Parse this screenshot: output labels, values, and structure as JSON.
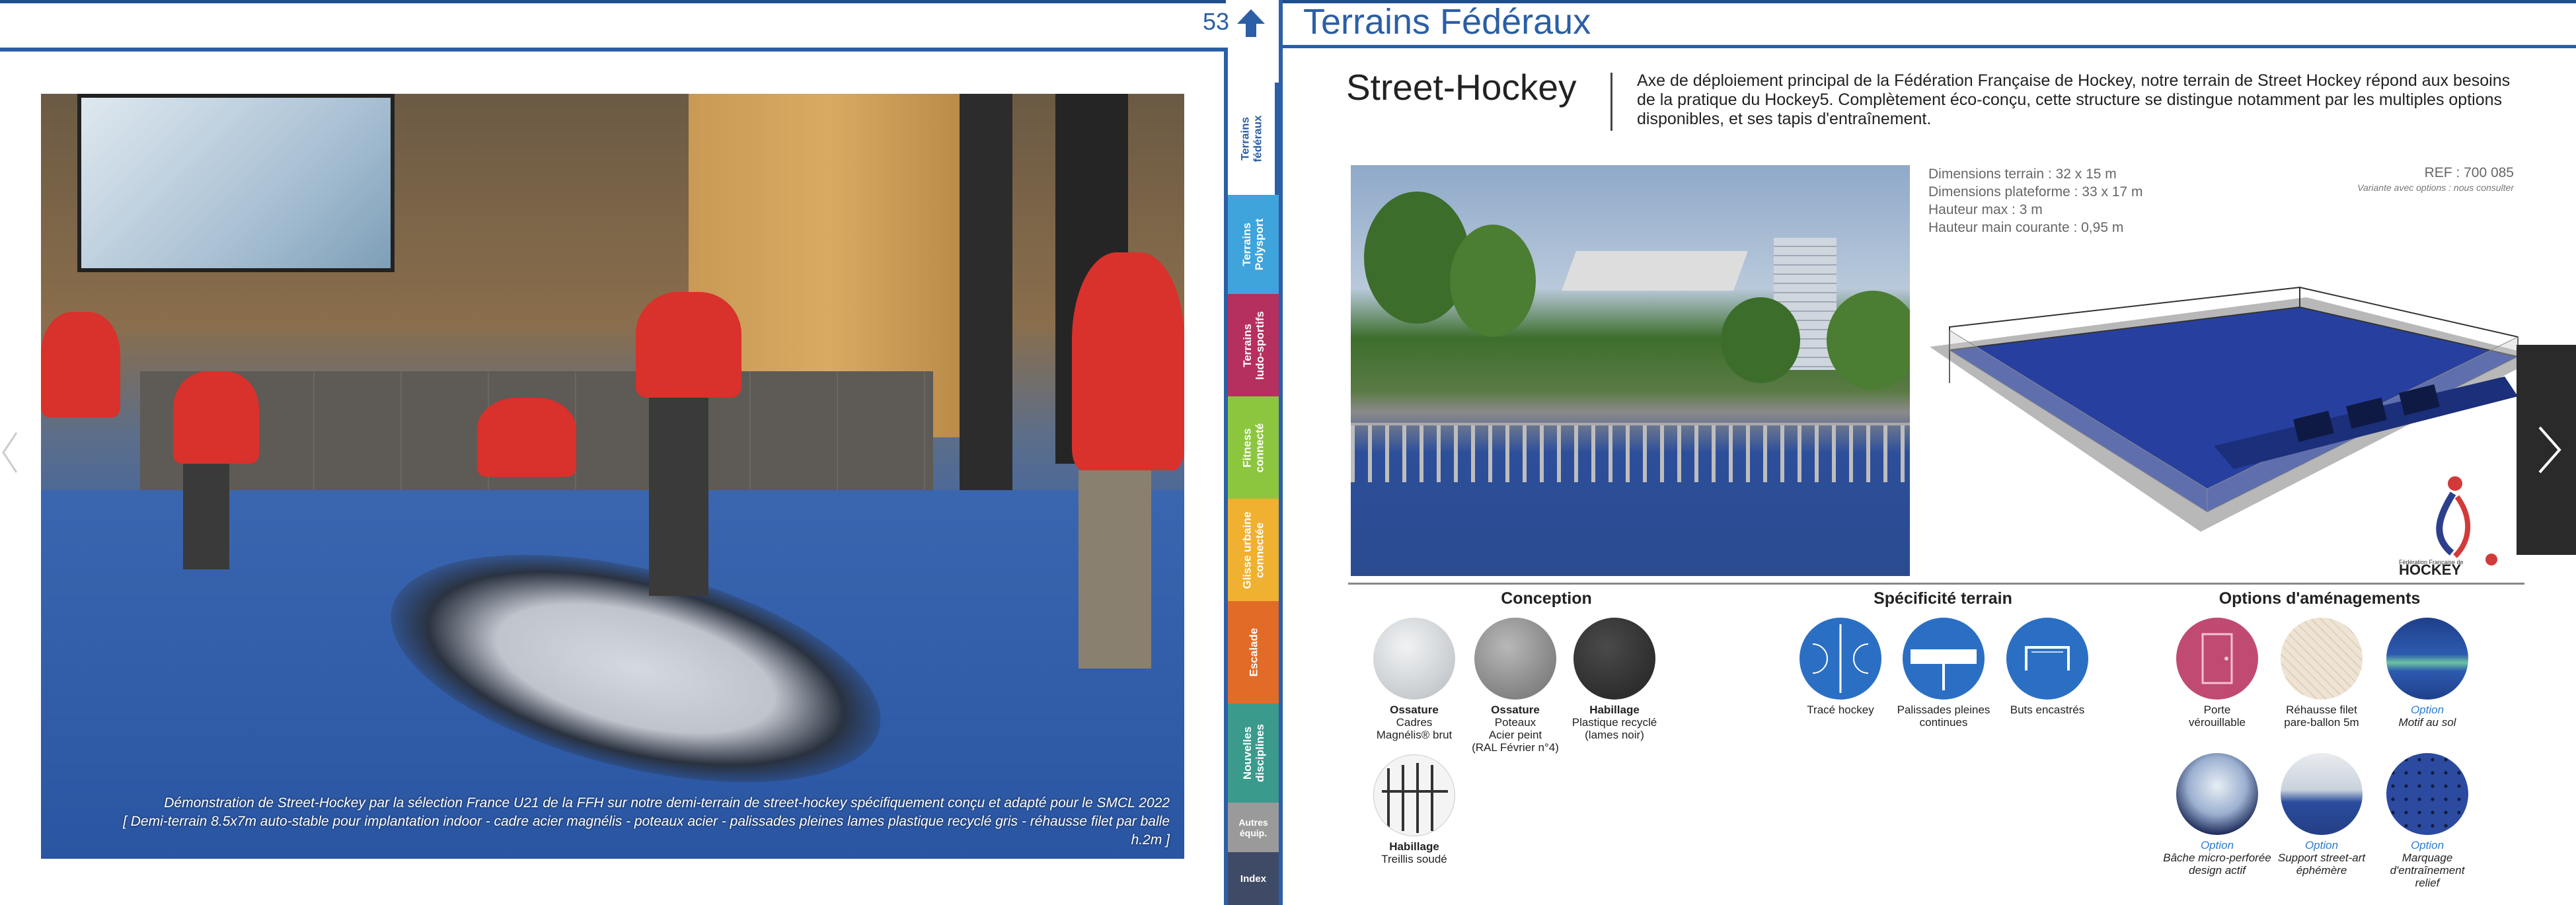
{
  "left_page": {
    "page_number": "53",
    "caption_line1": "Démonstration de Street-Hockey par la sélection France U21 de la FFH sur notre demi-terrain de street-hockey spécifiquement conçu et adapté pour le SMCL 2022",
    "caption_line2": "[ Demi-terrain 8.5x7m auto-stable pour implantation indoor - cadre acier magnélis - poteaux acier - palissades pleines lames plastique recyclé gris - réhausse filet par balle h.2m ]"
  },
  "tabs": [
    {
      "label": "Terrains\nfédéraux",
      "color": "#ffffff",
      "active": true
    },
    {
      "label": "Terrains\nPolysport",
      "color": "#3fa4db",
      "active": false
    },
    {
      "label": "Terrains\nludo-sportifs",
      "color": "#b52f5f",
      "active": false
    },
    {
      "label": "Fitness\nconnecté",
      "color": "#8cc63e",
      "active": false
    },
    {
      "label": "Glisse urbaine\nconnectée",
      "color": "#f0b030",
      "active": false
    },
    {
      "label": "Escalade",
      "color": "#e26b27",
      "active": false
    },
    {
      "label": "Nouvelles\ndisciplines",
      "color": "#3a9a8c",
      "active": false
    },
    {
      "label": "Autres\néquip.",
      "color": "#9a9a9a",
      "active": false
    },
    {
      "label": "Index",
      "color": "#3f4a66",
      "active": false
    }
  ],
  "right_page": {
    "section_title": "Terrains Fédéraux",
    "product_title": "Street-Hockey",
    "intro": "Axe de déploiement principal de la Fédération Française de Hockey, notre terrain de Street Hockey répond aux besoins de la pratique du Hockey5. Complètement éco-conçu, cette structure se distingue notamment par les multiples options disponibles, et ses tapis d'entraînement.",
    "specs": [
      "Dimensions terrain : 32 x 15 m",
      "Dimensions plateforme : 33 x 17 m",
      "Hauteur max : 3 m",
      "Hauteur main courante : 0,95 m"
    ],
    "ref": "REF : 700 085",
    "ref_note": "Variante avec options : nous consulter",
    "logo_text_small": "Fédération Française de",
    "logo_text_big": "HOCKEY",
    "conception": {
      "title": "Conception",
      "items": [
        {
          "title": "Ossature",
          "line1": "Cadres",
          "line2": "Magnélis® brut",
          "line3": "",
          "bg": "#d8dcdf"
        },
        {
          "title": "Ossature",
          "line1": "Poteaux",
          "line2": "Acier peint",
          "line3": "(RAL Février n°4)",
          "bg": "#9a9a9a"
        },
        {
          "title": "Habillage",
          "line1": "Plastique recyclé",
          "line2": "(lames noir)",
          "line3": "",
          "bg": "#3d3d3d"
        },
        {
          "title": "Habillage",
          "line1": "Treillis soudé",
          "line2": "",
          "line3": "",
          "bg": "#f2f2f2"
        }
      ]
    },
    "specificite": {
      "title": "Spécificité terrain",
      "items": [
        {
          "line1": "Tracé hockey",
          "line2": ""
        },
        {
          "line1": "Palissades pleines",
          "line2": "continues"
        },
        {
          "line1": "Buts encastrés",
          "line2": ""
        }
      ]
    },
    "options": {
      "title": "Options d'aménagements",
      "items": [
        {
          "opt": "",
          "line1": "Porte",
          "line2": "vérouillable",
          "italic": false
        },
        {
          "opt": "",
          "line1": "Réhausse filet",
          "line2": "pare-ballon 5m",
          "italic": false
        },
        {
          "opt": "Option",
          "line1": "Motif au sol",
          "line2": "",
          "italic": true
        },
        {
          "opt": "Option",
          "line1": "Bâche micro-perforée",
          "line2": "design actif",
          "italic": true
        },
        {
          "opt": "Option",
          "line1": "Support street-art",
          "line2": "éphémère",
          "italic": true
        },
        {
          "opt": "Option",
          "line1": "Marquage d'entraînement",
          "line2": "relief",
          "italic": true
        }
      ]
    }
  }
}
